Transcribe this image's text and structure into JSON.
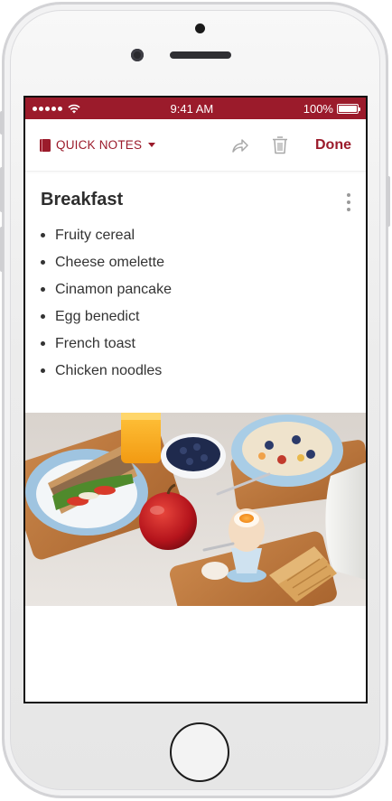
{
  "status_bar": {
    "time": "9:41 AM",
    "battery": "100%"
  },
  "toolbar": {
    "notebook_label": "QUICK NOTES",
    "done_label": "Done"
  },
  "note": {
    "title": "Breakfast",
    "items": [
      "Fruity cereal",
      "Cheese omelette",
      "Cinamon pancake",
      "Egg benedict",
      "French toast",
      "Chicken noodles"
    ]
  },
  "icons": {
    "notebook": "notebook-icon",
    "dropdown": "chevron-down-icon",
    "share": "share-icon",
    "trash": "trash-icon",
    "more": "more-vertical-icon",
    "wifi": "wifi-icon",
    "battery": "battery-icon"
  },
  "colors": {
    "accent": "#9b1b2b",
    "status_bar": "#9b1b2b",
    "text": "#333333"
  }
}
